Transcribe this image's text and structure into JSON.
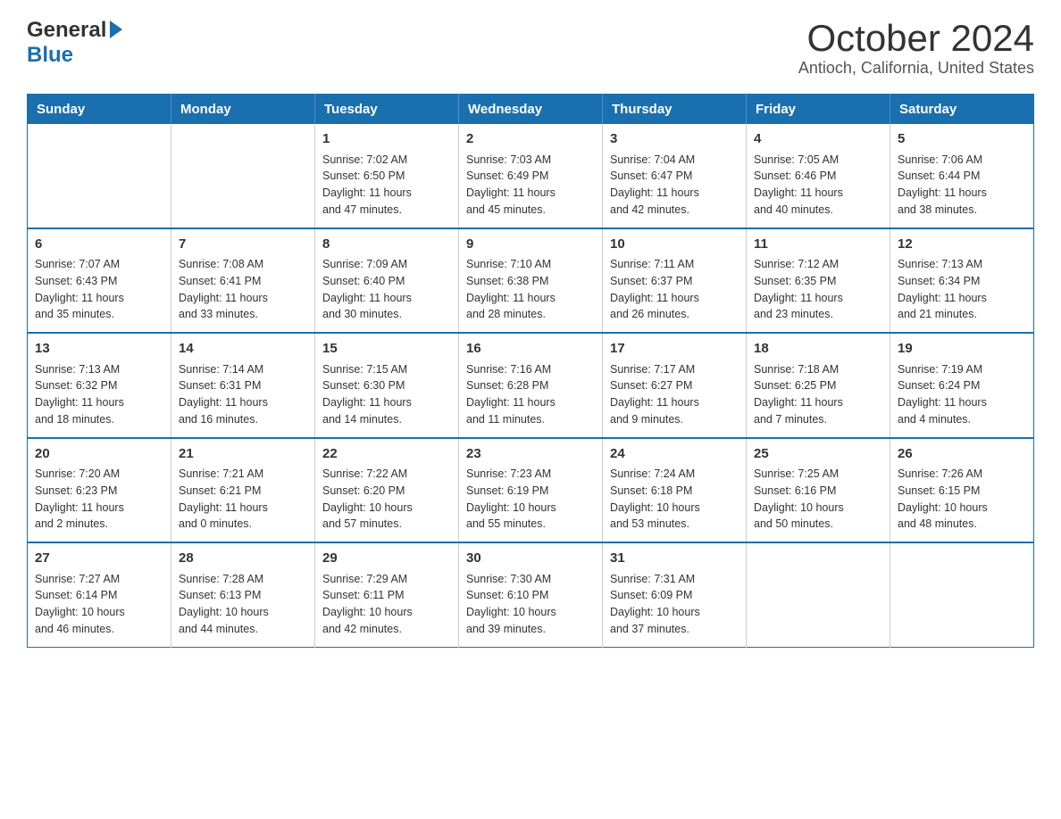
{
  "header": {
    "logo_general": "General",
    "logo_blue": "Blue",
    "month_title": "October 2024",
    "location": "Antioch, California, United States"
  },
  "days_of_week": [
    "Sunday",
    "Monday",
    "Tuesday",
    "Wednesday",
    "Thursday",
    "Friday",
    "Saturday"
  ],
  "weeks": [
    [
      {
        "day": "",
        "info": ""
      },
      {
        "day": "",
        "info": ""
      },
      {
        "day": "1",
        "info": "Sunrise: 7:02 AM\nSunset: 6:50 PM\nDaylight: 11 hours\nand 47 minutes."
      },
      {
        "day": "2",
        "info": "Sunrise: 7:03 AM\nSunset: 6:49 PM\nDaylight: 11 hours\nand 45 minutes."
      },
      {
        "day": "3",
        "info": "Sunrise: 7:04 AM\nSunset: 6:47 PM\nDaylight: 11 hours\nand 42 minutes."
      },
      {
        "day": "4",
        "info": "Sunrise: 7:05 AM\nSunset: 6:46 PM\nDaylight: 11 hours\nand 40 minutes."
      },
      {
        "day": "5",
        "info": "Sunrise: 7:06 AM\nSunset: 6:44 PM\nDaylight: 11 hours\nand 38 minutes."
      }
    ],
    [
      {
        "day": "6",
        "info": "Sunrise: 7:07 AM\nSunset: 6:43 PM\nDaylight: 11 hours\nand 35 minutes."
      },
      {
        "day": "7",
        "info": "Sunrise: 7:08 AM\nSunset: 6:41 PM\nDaylight: 11 hours\nand 33 minutes."
      },
      {
        "day": "8",
        "info": "Sunrise: 7:09 AM\nSunset: 6:40 PM\nDaylight: 11 hours\nand 30 minutes."
      },
      {
        "day": "9",
        "info": "Sunrise: 7:10 AM\nSunset: 6:38 PM\nDaylight: 11 hours\nand 28 minutes."
      },
      {
        "day": "10",
        "info": "Sunrise: 7:11 AM\nSunset: 6:37 PM\nDaylight: 11 hours\nand 26 minutes."
      },
      {
        "day": "11",
        "info": "Sunrise: 7:12 AM\nSunset: 6:35 PM\nDaylight: 11 hours\nand 23 minutes."
      },
      {
        "day": "12",
        "info": "Sunrise: 7:13 AM\nSunset: 6:34 PM\nDaylight: 11 hours\nand 21 minutes."
      }
    ],
    [
      {
        "day": "13",
        "info": "Sunrise: 7:13 AM\nSunset: 6:32 PM\nDaylight: 11 hours\nand 18 minutes."
      },
      {
        "day": "14",
        "info": "Sunrise: 7:14 AM\nSunset: 6:31 PM\nDaylight: 11 hours\nand 16 minutes."
      },
      {
        "day": "15",
        "info": "Sunrise: 7:15 AM\nSunset: 6:30 PM\nDaylight: 11 hours\nand 14 minutes."
      },
      {
        "day": "16",
        "info": "Sunrise: 7:16 AM\nSunset: 6:28 PM\nDaylight: 11 hours\nand 11 minutes."
      },
      {
        "day": "17",
        "info": "Sunrise: 7:17 AM\nSunset: 6:27 PM\nDaylight: 11 hours\nand 9 minutes."
      },
      {
        "day": "18",
        "info": "Sunrise: 7:18 AM\nSunset: 6:25 PM\nDaylight: 11 hours\nand 7 minutes."
      },
      {
        "day": "19",
        "info": "Sunrise: 7:19 AM\nSunset: 6:24 PM\nDaylight: 11 hours\nand 4 minutes."
      }
    ],
    [
      {
        "day": "20",
        "info": "Sunrise: 7:20 AM\nSunset: 6:23 PM\nDaylight: 11 hours\nand 2 minutes."
      },
      {
        "day": "21",
        "info": "Sunrise: 7:21 AM\nSunset: 6:21 PM\nDaylight: 11 hours\nand 0 minutes."
      },
      {
        "day": "22",
        "info": "Sunrise: 7:22 AM\nSunset: 6:20 PM\nDaylight: 10 hours\nand 57 minutes."
      },
      {
        "day": "23",
        "info": "Sunrise: 7:23 AM\nSunset: 6:19 PM\nDaylight: 10 hours\nand 55 minutes."
      },
      {
        "day": "24",
        "info": "Sunrise: 7:24 AM\nSunset: 6:18 PM\nDaylight: 10 hours\nand 53 minutes."
      },
      {
        "day": "25",
        "info": "Sunrise: 7:25 AM\nSunset: 6:16 PM\nDaylight: 10 hours\nand 50 minutes."
      },
      {
        "day": "26",
        "info": "Sunrise: 7:26 AM\nSunset: 6:15 PM\nDaylight: 10 hours\nand 48 minutes."
      }
    ],
    [
      {
        "day": "27",
        "info": "Sunrise: 7:27 AM\nSunset: 6:14 PM\nDaylight: 10 hours\nand 46 minutes."
      },
      {
        "day": "28",
        "info": "Sunrise: 7:28 AM\nSunset: 6:13 PM\nDaylight: 10 hours\nand 44 minutes."
      },
      {
        "day": "29",
        "info": "Sunrise: 7:29 AM\nSunset: 6:11 PM\nDaylight: 10 hours\nand 42 minutes."
      },
      {
        "day": "30",
        "info": "Sunrise: 7:30 AM\nSunset: 6:10 PM\nDaylight: 10 hours\nand 39 minutes."
      },
      {
        "day": "31",
        "info": "Sunrise: 7:31 AM\nSunset: 6:09 PM\nDaylight: 10 hours\nand 37 minutes."
      },
      {
        "day": "",
        "info": ""
      },
      {
        "day": "",
        "info": ""
      }
    ]
  ]
}
